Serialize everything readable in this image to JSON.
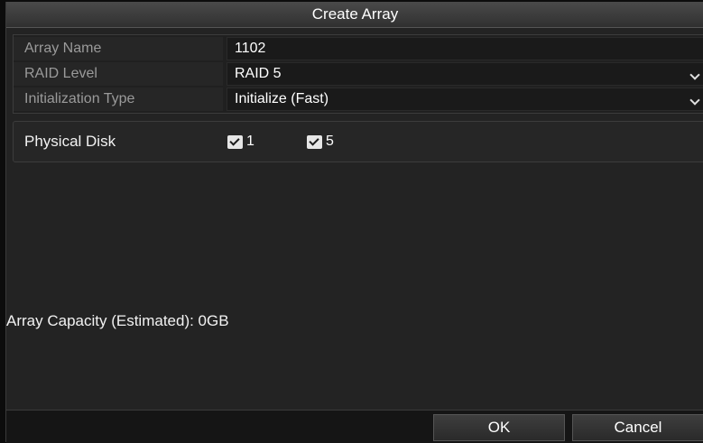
{
  "dialog": {
    "title": "Create Array"
  },
  "form": {
    "array_name": {
      "label": "Array Name",
      "value": "1102"
    },
    "raid_level": {
      "label": "RAID Level",
      "value": "RAID 5"
    },
    "init_type": {
      "label": "Initialization Type",
      "value": "Initialize (Fast)"
    }
  },
  "physical_disk": {
    "label": "Physical Disk",
    "disks": [
      {
        "label": "1",
        "checked": true
      },
      {
        "label": "5",
        "checked": true
      }
    ]
  },
  "capacity_text": "Array Capacity (Estimated): 0GB",
  "buttons": {
    "ok": "OK",
    "cancel": "Cancel"
  },
  "icons": {
    "dropdown": "chevron-down-icon",
    "checkbox": "checkbox-checked-icon"
  },
  "colors": {
    "background": "#232323",
    "titlebar": "#3c3c3c",
    "field": "#1a1a1a"
  }
}
